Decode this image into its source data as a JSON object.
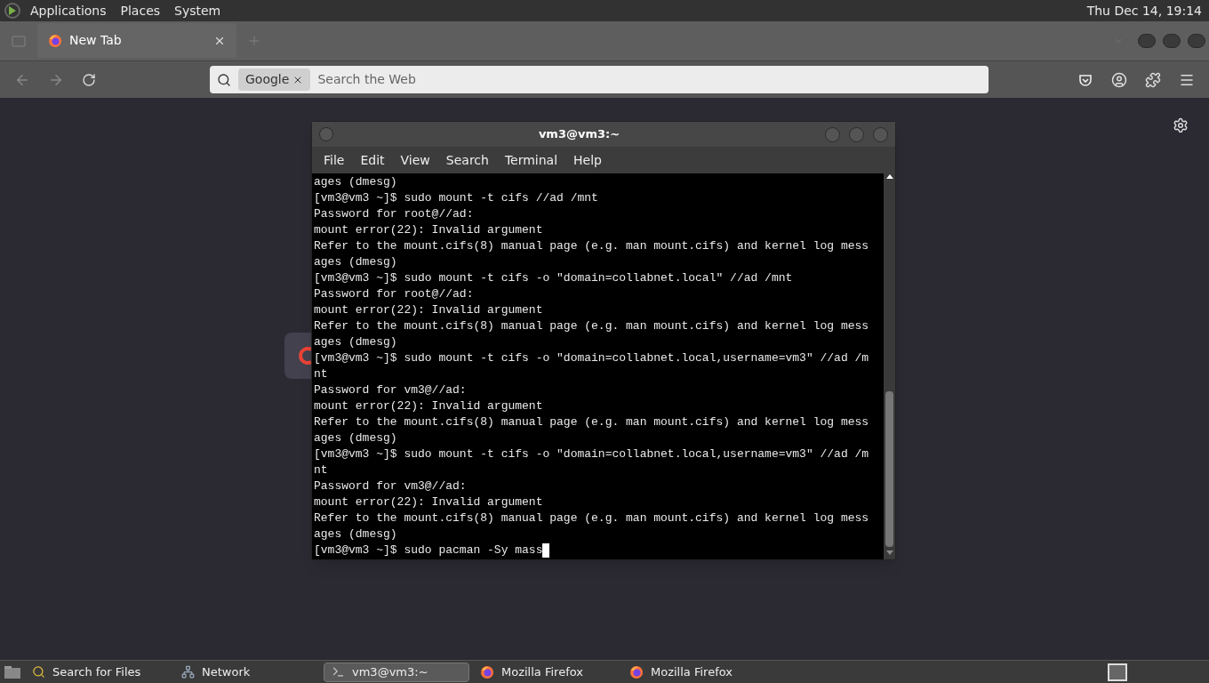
{
  "top_panel": {
    "menus": [
      "Applications",
      "Places",
      "System"
    ],
    "clock": "Thu Dec 14, 19:14"
  },
  "browser": {
    "tabs": [
      {
        "label": "New Tab",
        "selected": true
      }
    ],
    "search": {
      "engine": "Google",
      "placeholder": "Search the Web"
    }
  },
  "terminal": {
    "title": "vm3@vm3:~",
    "menus": [
      "File",
      "Edit",
      "View",
      "Search",
      "Terminal",
      "Help"
    ],
    "lines": [
      "ages (dmesg)",
      "[vm3@vm3 ~]$ sudo mount -t cifs //ad /mnt",
      "Password for root@//ad:",
      "mount error(22): Invalid argument",
      "Refer to the mount.cifs(8) manual page (e.g. man mount.cifs) and kernel log mess",
      "ages (dmesg)",
      "[vm3@vm3 ~]$ sudo mount -t cifs -o \"domain=collabnet.local\" //ad /mnt",
      "Password for root@//ad:",
      "mount error(22): Invalid argument",
      "Refer to the mount.cifs(8) manual page (e.g. man mount.cifs) and kernel log mess",
      "ages (dmesg)",
      "[vm3@vm3 ~]$ sudo mount -t cifs -o \"domain=collabnet.local,username=vm3\" //ad /m",
      "nt",
      "Password for vm3@//ad:",
      "mount error(22): Invalid argument",
      "Refer to the mount.cifs(8) manual page (e.g. man mount.cifs) and kernel log mess",
      "ages (dmesg)",
      "[vm3@vm3 ~]$ sudo mount -t cifs -o \"domain=collabnet.local,username=vm3\" //ad /m",
      "nt",
      "Password for vm3@//ad:",
      "mount error(22): Invalid argument",
      "Refer to the mount.cifs(8) manual page (e.g. man mount.cifs) and kernel log mess",
      "ages (dmesg)",
      "[vm3@vm3 ~]$ sudo pacman -Sy mass"
    ],
    "cursor_visible": true
  },
  "taskbar": {
    "items": [
      {
        "kind": "search",
        "label": "Search for Files",
        "selected": false
      },
      {
        "kind": "network",
        "label": "Network",
        "selected": false
      },
      {
        "kind": "terminal",
        "label": "vm3@vm3:~",
        "selected": true
      },
      {
        "kind": "firefox",
        "label": "Mozilla Firefox",
        "selected": false
      },
      {
        "kind": "firefox",
        "label": "Mozilla Firefox",
        "selected": false
      }
    ]
  }
}
